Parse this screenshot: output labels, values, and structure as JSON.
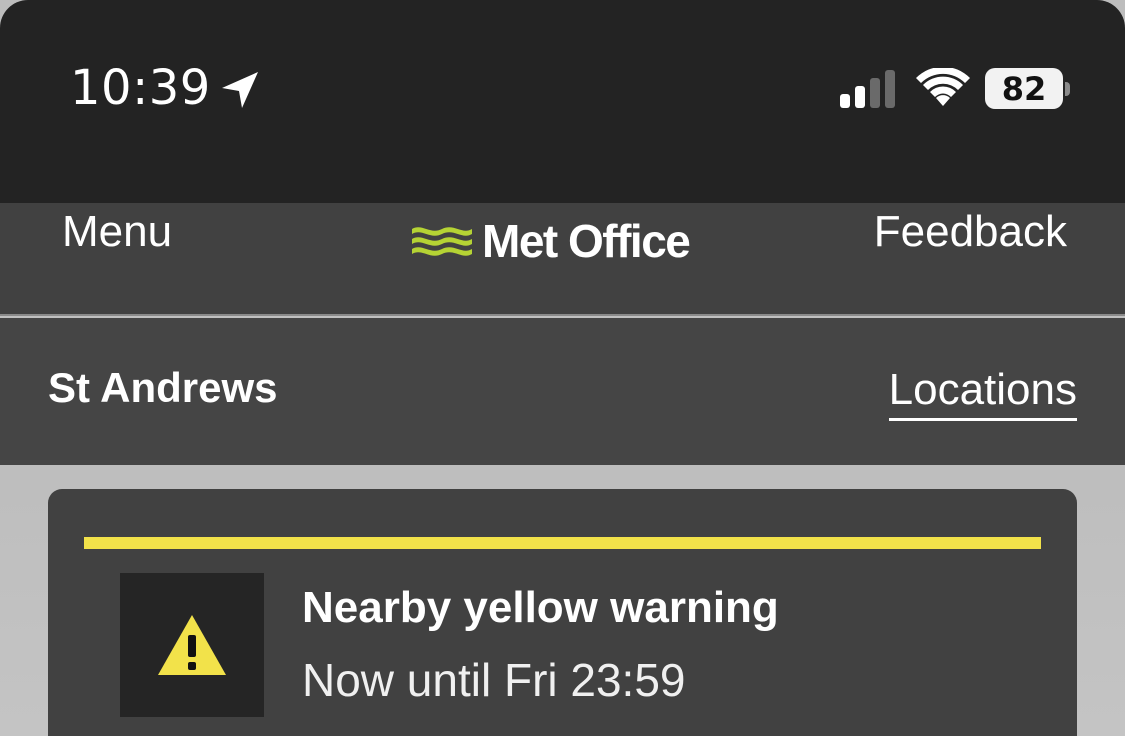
{
  "status_bar": {
    "time": "10:39",
    "battery": "82",
    "icons": [
      "location-arrow-icon",
      "cellular-signal-icon",
      "wifi-icon",
      "battery-icon"
    ]
  },
  "header": {
    "menu_label": "Menu",
    "logo_text": "Met Office",
    "feedback_label": "Feedback",
    "logo_color": "#b5d334"
  },
  "location": {
    "name": "St Andrews",
    "locations_label": "Locations"
  },
  "warning": {
    "title": "Nearby yellow warning",
    "period": "Now until Fri 23:59",
    "color": "#f2e24a",
    "icon": "warning-triangle-icon"
  }
}
